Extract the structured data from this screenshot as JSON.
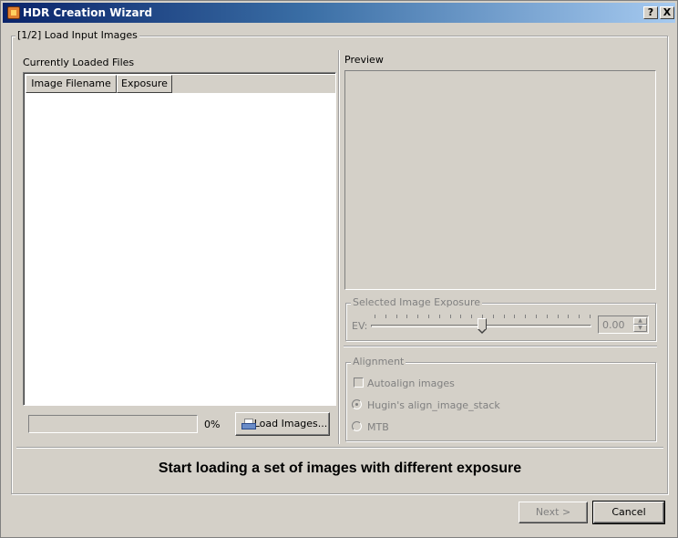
{
  "window": {
    "title": "HDR Creation Wizard",
    "help_label": "?",
    "close_label": "X"
  },
  "step": {
    "title": "[1/2] Load Input Images"
  },
  "files": {
    "label": "Currently Loaded Files",
    "columns": [
      "Image Filename",
      "Exposure"
    ],
    "rows": []
  },
  "progress": {
    "value": 0,
    "text": "0%"
  },
  "load_button": {
    "label": "Load Images..."
  },
  "preview": {
    "label": "Preview"
  },
  "exposure": {
    "group_title": "Selected Image Exposure",
    "ev_label": "EV:",
    "value_text": "0.00",
    "slider_fraction": 0.5,
    "enabled": false
  },
  "alignment": {
    "group_title": "Alignment",
    "autoalign_label": "Autoalign images",
    "autoalign_checked": false,
    "options": [
      "Hugin's align_image_stack",
      "MTB"
    ],
    "selected_option": "Hugin's align_image_stack"
  },
  "status": {
    "message": "Start loading a set of images with different exposure"
  },
  "footer": {
    "next_label": "Next >",
    "cancel_label": "Cancel"
  },
  "icons": {
    "app": "hdr-app-icon",
    "load": "load-images-icon"
  }
}
